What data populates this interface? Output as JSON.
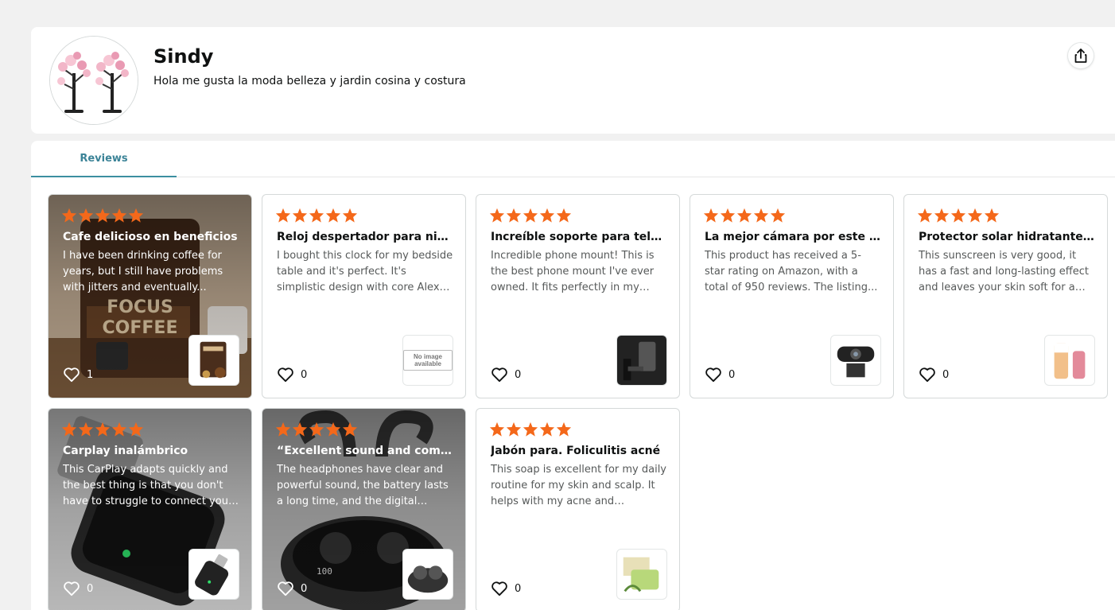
{
  "profile": {
    "name": "Sindy",
    "bio": "Hola me gusta la moda belleza y jardin cosina y costura"
  },
  "tabs": [
    {
      "label": "Reviews",
      "active": true
    }
  ],
  "colors": {
    "star": "#f4681a",
    "tab_accent": "#3b8fa0"
  },
  "reviews": [
    {
      "rating": 5,
      "title": "Cafe delicioso en beneficios",
      "body": "I have been drinking coffee for years, but I still have problems with jitters and eventually...",
      "likes": "1",
      "image_background": true,
      "product": "coffee"
    },
    {
      "rating": 5,
      "title": "Reloj despertador para niños",
      "body": "I bought this clock for my bedside table and it's perfect. It's simplistic design with core Alexa features...",
      "likes": "0",
      "image_background": false,
      "product": "no-image",
      "no_image_text": "No image available"
    },
    {
      "rating": 5,
      "title": "Increíble soporte para teléfono",
      "body": "Incredible phone mount! This is the best phone mount I've ever owned. It fits perfectly in my car...",
      "likes": "0",
      "image_background": false,
      "product": "phone-mount"
    },
    {
      "rating": 5,
      "title": "La mejor cámara por este precio",
      "body": "This product has received a 5-star rating on Amazon, with a total of 950 reviews. The listing...",
      "likes": "0",
      "image_background": false,
      "product": "webcam"
    },
    {
      "rating": 5,
      "title": "Protector solar hidratante para la piel",
      "body": "This sunscreen is very good, it has a fast and long-lasting effect and leaves your skin soft for a long time...",
      "likes": "0",
      "image_background": false,
      "product": "sunscreen"
    },
    {
      "rating": 5,
      "title": "Carplay inalámbrico",
      "body": "This CarPlay adapts quickly and the best thing is that you don't have to struggle to connect your phone...",
      "likes": "0",
      "image_background": true,
      "product": "carplay"
    },
    {
      "rating": 5,
      "title": "“Excellent sound and comfort”",
      "body": "The headphones have clear and powerful sound, the battery lasts a long time, and the digital display...",
      "likes": "0",
      "image_background": true,
      "product": "earbuds"
    },
    {
      "rating": 5,
      "title": "Jabón para. Foliculitis acné",
      "body": "This soap is excellent for my daily routine for my skin and scalp. It helps with my acne and dandruff...",
      "likes": "0",
      "image_background": false,
      "product": "soap"
    }
  ]
}
